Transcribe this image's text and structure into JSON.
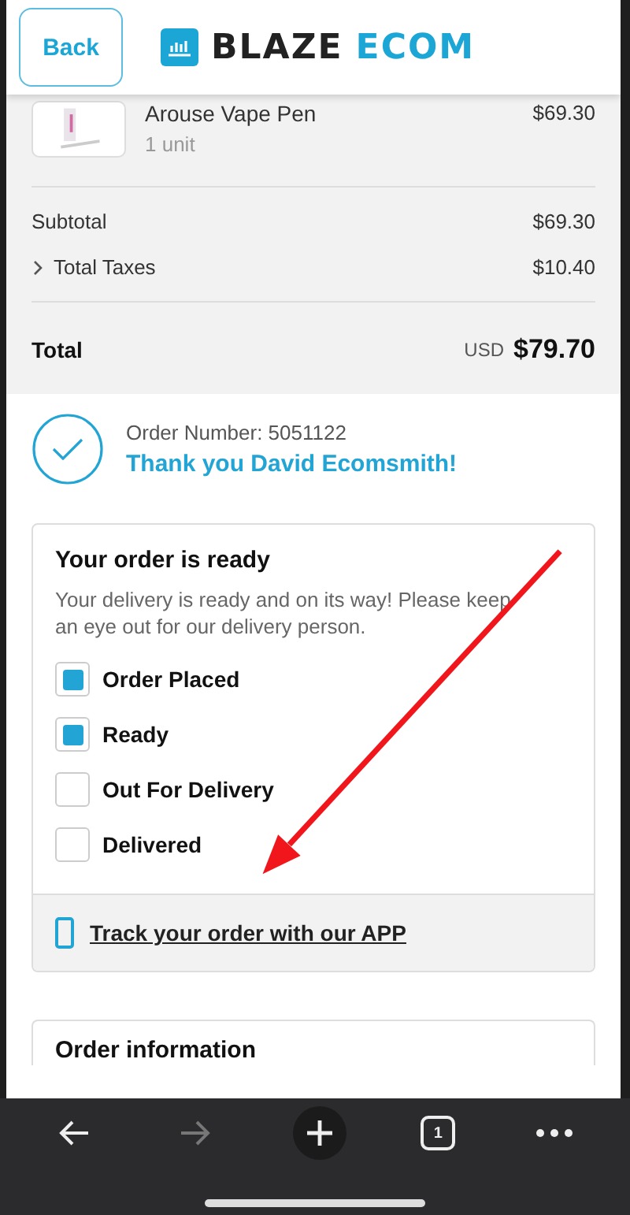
{
  "header": {
    "back_button": "Back",
    "brand": [
      "BLAZE",
      "ECOM"
    ]
  },
  "line_items": [
    {
      "name": "Arouse Vape Pen",
      "quantity": "1 unit",
      "price": "$69.30"
    }
  ],
  "summary": [
    {
      "label": "Subtotal",
      "value": "$69.30",
      "expandable": false
    },
    {
      "label": "Total Taxes",
      "value": "$10.40",
      "expandable": true
    }
  ],
  "total": {
    "label": "Total",
    "currency": "USD",
    "value": "$79.70"
  },
  "confirmation": {
    "order_number": "Order Number: 5051122",
    "thanks": "Thank you David Ecomsmith!"
  },
  "status_card": {
    "title": "Your order is ready",
    "message": "Your delivery is ready and on its way! Please keep an eye out for our delivery person.",
    "steps": [
      {
        "label": "Order Placed",
        "checked": true
      },
      {
        "label": "Ready",
        "checked": true
      },
      {
        "label": "Out For Delivery",
        "checked": false
      },
      {
        "label": "Delivered",
        "checked": false
      }
    ],
    "track_link": "Track your order with our APP"
  },
  "info_card": {
    "title": "Order information"
  },
  "browser_bar": {
    "tab_count": "1"
  }
}
